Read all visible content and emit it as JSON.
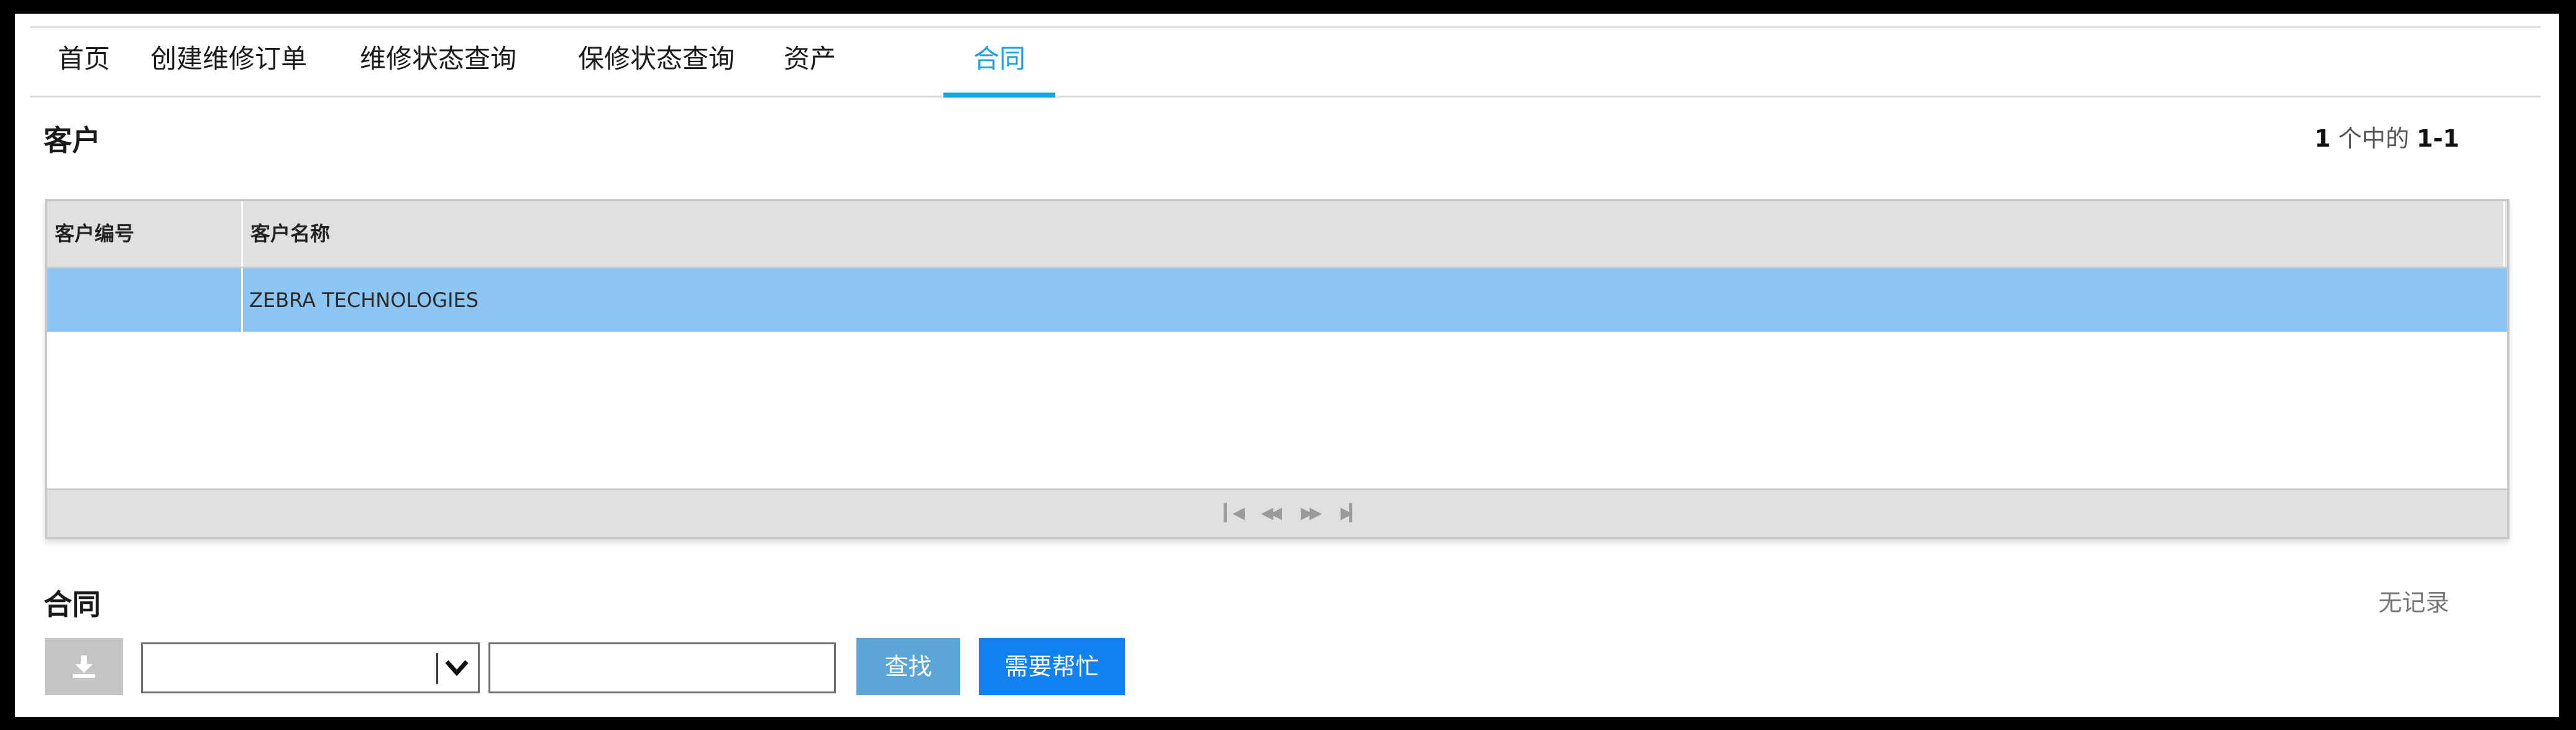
{
  "tabs": [
    {
      "label": "首页"
    },
    {
      "label": "创建维修订单"
    },
    {
      "label": "维修状态查询"
    },
    {
      "label": "保修状态查询"
    },
    {
      "label": "资产"
    },
    {
      "label": "合同",
      "active": true
    }
  ],
  "customer_section": {
    "title": "客户",
    "count": {
      "total": "1",
      "middle": " 个中的 ",
      "range": "1-1"
    },
    "columns": [
      "客户编号",
      "客户名称"
    ],
    "rows": [
      {
        "id": "",
        "name": "ZEBRA TECHNOLOGIES",
        "selected": true
      }
    ],
    "pager_icons": [
      "first-page-icon",
      "prev-page-icon",
      "next-page-icon",
      "last-page-icon"
    ]
  },
  "contract_section": {
    "title": "合同",
    "status": "无记录",
    "download_icon": "download-icon",
    "select_value": "",
    "search_value": "",
    "search_button": "查找",
    "help_button": "需要帮忙"
  },
  "colors": {
    "active_tab": "#1aa1e5",
    "selected_row": "#8cc6f4",
    "search_button": "#5ba6d6",
    "help_button": "#1181f0"
  }
}
